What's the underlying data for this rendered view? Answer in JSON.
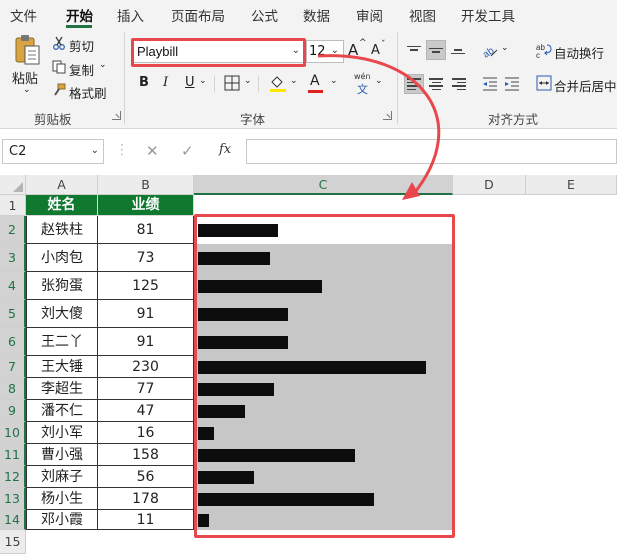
{
  "menu": [
    "文件",
    "开始",
    "插入",
    "页面布局",
    "公式",
    "数据",
    "审阅",
    "视图",
    "开发工具"
  ],
  "clipboard": {
    "paste_label": "粘贴",
    "cut_label": "剪切",
    "copy_label": "复制",
    "format_painter_label": "格式刷",
    "group_label": "剪贴板"
  },
  "font": {
    "name": "Playbill",
    "size": "12",
    "bold": "B",
    "italic": "I",
    "underline": "U",
    "font_color": "A",
    "phonetic": "wén",
    "phonetic_char": "文",
    "increase": "A",
    "decrease": "A",
    "group_label": "字体"
  },
  "alignment": {
    "wrap_text_label": "自动换行",
    "merge_center_label": "合并后居中",
    "group_label": "对齐方式"
  },
  "formula_bar": {
    "name_box": "C2",
    "cancel_icon": "✕",
    "enter_icon": "✓",
    "fx_label": "fx",
    "formula": ""
  },
  "columns": [
    "A",
    "B",
    "C",
    "D",
    "E"
  ],
  "rows": [
    "1",
    "2",
    "3",
    "4",
    "5",
    "6",
    "7",
    "8",
    "9",
    "10",
    "11",
    "12",
    "13",
    "14",
    "15"
  ],
  "table": {
    "header_name": "姓名",
    "header_value": "业绩",
    "records": [
      {
        "name": "赵铁柱",
        "value": "81"
      },
      {
        "name": "小肉包",
        "value": "73"
      },
      {
        "name": "张狗蛋",
        "value": "125"
      },
      {
        "name": "刘大傻",
        "value": "91"
      },
      {
        "name": "王二丫",
        "value": "91"
      },
      {
        "name": "王大锤",
        "value": "230"
      },
      {
        "name": "李超生",
        "value": "77"
      },
      {
        "name": "潘不仁",
        "value": "47"
      },
      {
        "name": "刘小军",
        "value": "16"
      },
      {
        "name": "曹小强",
        "value": "158"
      },
      {
        "name": "刘麻子",
        "value": "56"
      },
      {
        "name": "杨小生",
        "value": "178"
      },
      {
        "name": "邓小霞",
        "value": "11"
      }
    ]
  },
  "colors": {
    "header_fill": "#0f7a2f",
    "accent": "#217346",
    "bar": "#0c0c0c",
    "selection": "#c7c7c7",
    "highlight": "#e8474b"
  }
}
